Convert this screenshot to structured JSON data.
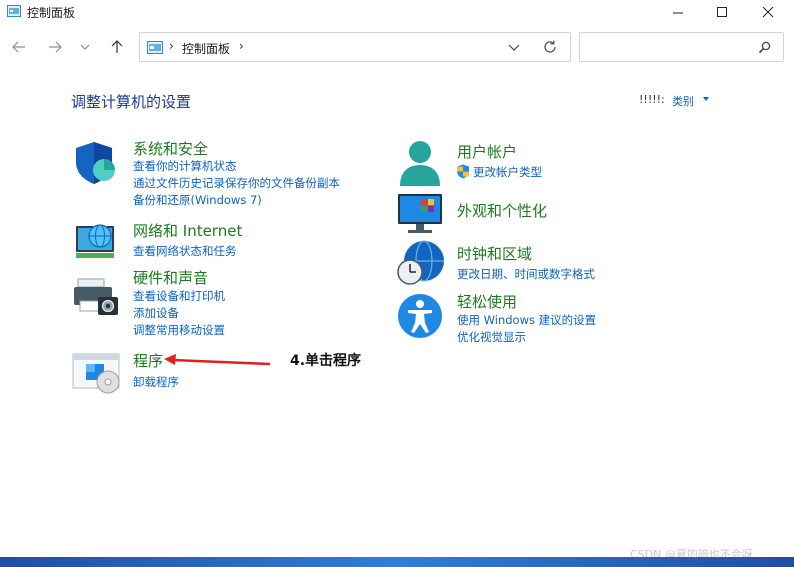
{
  "window": {
    "title": "控制面板"
  },
  "address": {
    "path": "控制面板",
    "search_placeholder": ""
  },
  "header": {
    "title": "调整计算机的设置",
    "view_by_label": "!!!!!:",
    "view_by_value": "类别"
  },
  "categories": {
    "system": {
      "title": "系统和安全",
      "links": [
        "查看你的计算机状态",
        "通过文件历史记录保存你的文件备份副本",
        "备份和还原(Windows 7)"
      ]
    },
    "network": {
      "title": "网络和 Internet",
      "links": [
        "查看网络状态和任务"
      ]
    },
    "hardware": {
      "title": "硬件和声音",
      "links": [
        "查看设备和打印机",
        "添加设备",
        "调整常用移动设置"
      ]
    },
    "programs": {
      "title": "程序",
      "links": [
        "卸载程序"
      ]
    },
    "users": {
      "title": "用户帐户",
      "links": [
        "更改帐户类型"
      ]
    },
    "appearance": {
      "title": "外观和个性化",
      "links": []
    },
    "clock": {
      "title": "时钟和区域",
      "links": [
        "更改日期、时间或数字格式"
      ]
    },
    "ease": {
      "title": "轻松使用",
      "links": [
        "使用 Windows 建议的设置",
        "优化视觉显示"
      ]
    }
  },
  "annotation": {
    "text": "4.单击程序",
    "color": "#e02020"
  },
  "watermark": "CSDN @夏的暗也不会呀",
  "colors": {
    "category_title": "#1e7a1e",
    "link": "#0b63c4",
    "page_title": "#1f3b8c"
  }
}
